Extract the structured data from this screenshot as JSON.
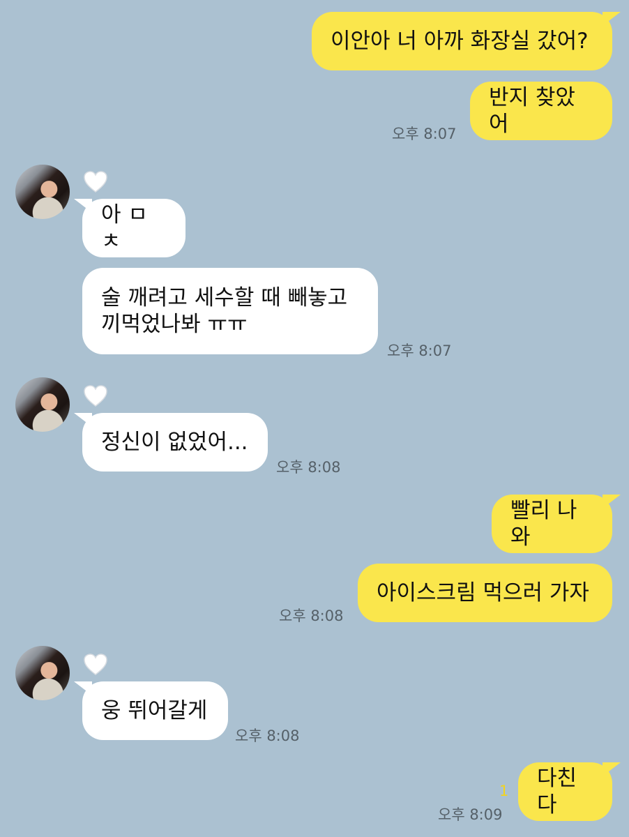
{
  "colors": {
    "background": "#abc1d1",
    "my_bubble": "#fae64c",
    "their_bubble": "#ffffff",
    "unread_count": "#f3d41c"
  },
  "messages": [
    {
      "sender": "me",
      "text": "이안아 너 아까 화장실 갔어?"
    },
    {
      "sender": "me",
      "text": "반지 찾았어",
      "time": "오후 8:07"
    },
    {
      "sender": "them",
      "text": "아 ㅁㅊ"
    },
    {
      "sender": "them",
      "text": "술 깨려고 세수할 때 빼놓고\n끼먹었나봐 ㅠㅠ",
      "time": "오후 8:07"
    },
    {
      "sender": "them",
      "text": "정신이 없었어...",
      "time": "오후 8:08"
    },
    {
      "sender": "me",
      "text": "빨리 나와"
    },
    {
      "sender": "me",
      "text": "아이스크림 먹으러 가자",
      "time": "오후 8:08"
    },
    {
      "sender": "them",
      "text": "웅 뛰어갈게",
      "time": "오후 8:08"
    },
    {
      "sender": "me",
      "text": "다친다",
      "time": "오후 8:09",
      "unread": "1"
    }
  ],
  "icons": {
    "profile": "profile-avatar",
    "reaction": "heart-icon"
  }
}
